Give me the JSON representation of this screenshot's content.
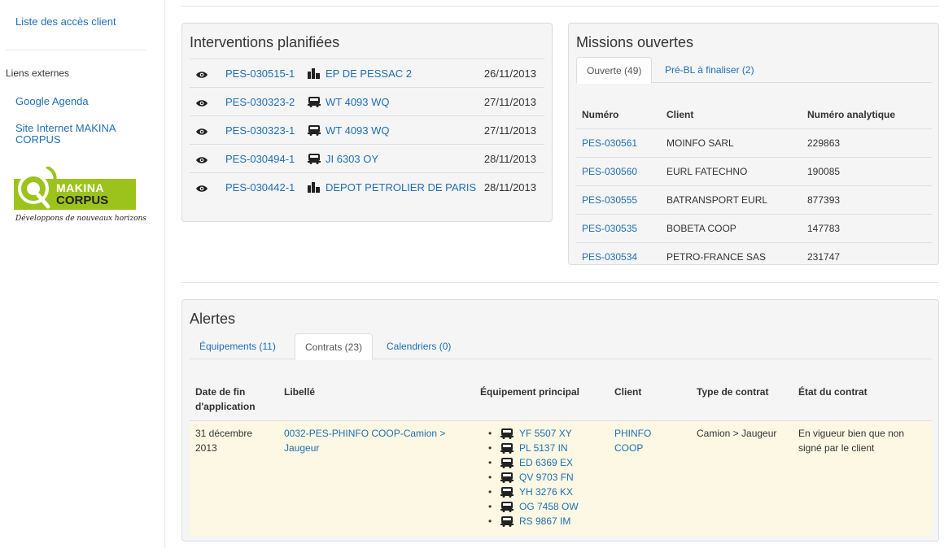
{
  "sidebar": {
    "client_access_link": "Liste des accès client",
    "external_links_header": "Liens externes",
    "google_agenda_link": "Google Agenda",
    "makina_site_link": "Site Internet MAKINA CORPUS",
    "logo": {
      "line1": "MAKINA",
      "line2": "CORPUS",
      "tagline": "Développons de nouveaux horizons"
    }
  },
  "interventions": {
    "title": "Interventions planifiées",
    "rows": [
      {
        "ref": "PES-030515-1",
        "icon": "building-icon",
        "site": "EP DE PESSAC 2",
        "date": "26/11/2013"
      },
      {
        "ref": "PES-030323-2",
        "icon": "truck-icon",
        "site": "WT 4093 WQ",
        "date": "27/11/2013"
      },
      {
        "ref": "PES-030323-1",
        "icon": "truck-icon",
        "site": "WT 4093 WQ",
        "date": "27/11/2013"
      },
      {
        "ref": "PES-030494-1",
        "icon": "truck-icon",
        "site": "JI 6303 OY",
        "date": "28/11/2013"
      },
      {
        "ref": "PES-030442-1",
        "icon": "building-icon",
        "site": "DEPOT PETROLIER DE PARIS",
        "date": "28/11/2013"
      }
    ]
  },
  "missions": {
    "title": "Missions ouvertes",
    "tabs": [
      {
        "label": "Ouverte (49)",
        "active": true
      },
      {
        "label": "Pré-BL à finaliser (2)",
        "active": false
      }
    ],
    "columns": [
      "Numéro",
      "Client",
      "Numéro analytique"
    ],
    "rows": [
      {
        "numero": "PES-030561",
        "client": "MOINFO SARL",
        "analytique": "229863"
      },
      {
        "numero": "PES-030560",
        "client": "EURL FATECHNO",
        "analytique": "190085"
      },
      {
        "numero": "PES-030555",
        "client": "BATRANSPORT EURL",
        "analytique": "877393"
      },
      {
        "numero": "PES-030535",
        "client": "BOBETA COOP",
        "analytique": "147783"
      },
      {
        "numero": "PES-030534",
        "client": "PETRO-FRANCE SAS",
        "analytique": "231747"
      }
    ]
  },
  "alerts": {
    "title": "Alertes",
    "tabs": [
      {
        "label": "Équipements (11)",
        "active": false
      },
      {
        "label": "Contrats (23)",
        "active": true
      },
      {
        "label": "Calendriers (0)",
        "active": false
      }
    ],
    "columns": {
      "date_line1": "Date de fin",
      "date_line2": "d'application",
      "libelle": "Libellé",
      "equipement": "Équipement principal",
      "client": "Client",
      "type": "Type de contrat",
      "etat": "État du contrat"
    },
    "row": {
      "date_line1": "31 décembre",
      "date_line2": "2013",
      "libelle_line1": "0032-PES-PHINFO COOP-Camion >",
      "libelle_line2": "Jaugeur",
      "equipements": [
        "YF 5507 XY",
        "PL 5137 IN",
        "ED 6369 EX",
        "QV 9703 FN",
        "YH 3276 KX",
        "OG 7458 OW",
        "RS 9867 IM"
      ],
      "client_line1": "PHINFO",
      "client_line2": "COOP",
      "type": "Camion > Jaugeur",
      "etat_line1": "En vigueur bien que non",
      "etat_line2": "signé par le client"
    }
  }
}
